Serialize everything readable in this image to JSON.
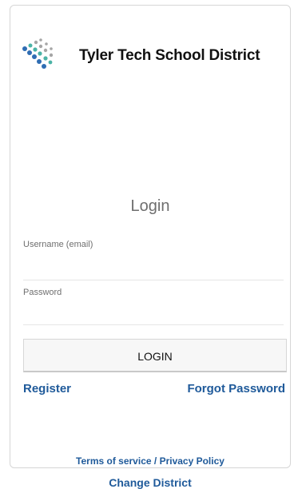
{
  "header": {
    "district_name": "Tyler Tech School District",
    "logo_icon": "tyler-dots-logo-icon"
  },
  "login": {
    "title": "Login",
    "username_label": "Username (email)",
    "password_label": "Password",
    "button_label": "LOGIN"
  },
  "links": {
    "register": "Register",
    "forgot_password": "Forgot Password"
  },
  "footer": {
    "terms": "Terms of service",
    "separator": " / ",
    "privacy": "Privacy Policy",
    "change_district": "Change District"
  },
  "colors": {
    "link": "#1f5a9a",
    "logo_blue": "#2f6db3",
    "logo_teal": "#4bb3a6",
    "logo_gray": "#a6a6a6"
  }
}
